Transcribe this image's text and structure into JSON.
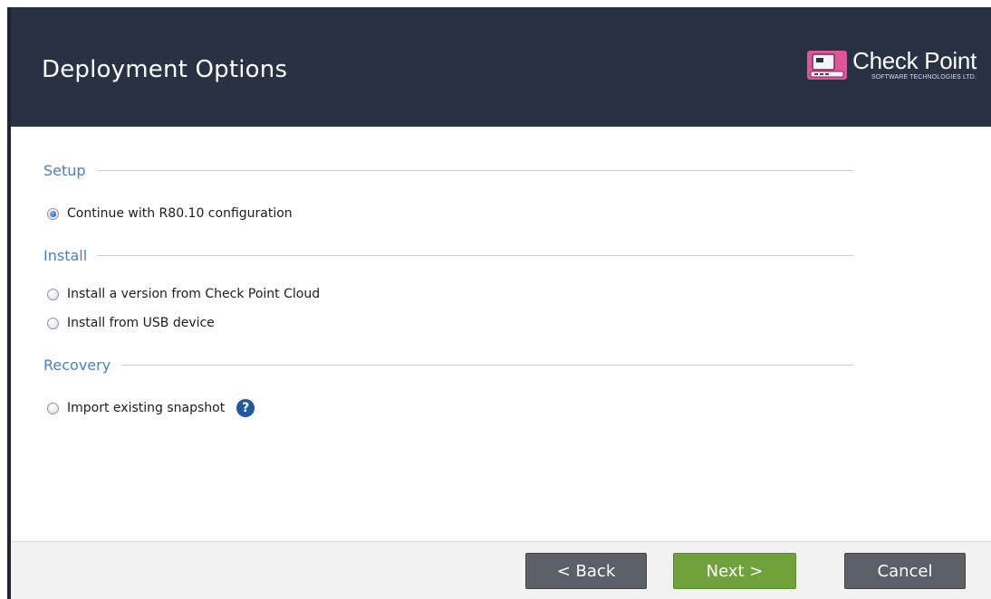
{
  "window": {
    "title": "Deployment Options"
  },
  "brand": {
    "name": "Check Point",
    "tagline": "SOFTWARE TECHNOLOGIES LTD.",
    "colors": {
      "header_bg": "#283244",
      "accent_green": "#6fa23a",
      "button_gray": "#5b5f66",
      "section_blue": "#4a7fc0",
      "logo_pink": "#e0559a"
    }
  },
  "sections": {
    "setup": {
      "label": "Setup",
      "options": [
        {
          "label": "Continue with R80.10 configuration",
          "checked": true
        }
      ]
    },
    "install": {
      "label": "Install",
      "options": [
        {
          "label": "Install a version from Check Point Cloud",
          "checked": false
        },
        {
          "label": "Install from USB device",
          "checked": false
        }
      ]
    },
    "recovery": {
      "label": "Recovery",
      "options": [
        {
          "label": "Import existing snapshot",
          "checked": false
        }
      ],
      "help_icon": "question-circle-icon",
      "help_glyph": "?"
    }
  },
  "footer": {
    "back_label": "< Back",
    "next_label": "Next >",
    "cancel_label": "Cancel"
  }
}
